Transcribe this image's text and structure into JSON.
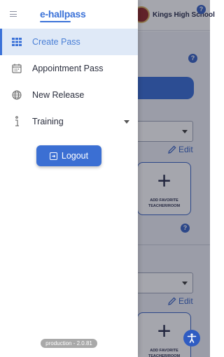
{
  "app": {
    "logo": "e-hallpass"
  },
  "menu": {
    "items": [
      {
        "label": "Create Pass",
        "icon": "grid-icon",
        "active": true
      },
      {
        "label": "Appointment Pass",
        "icon": "calendar-icon",
        "active": false
      },
      {
        "label": "New Release",
        "icon": "globe-icon",
        "active": false
      },
      {
        "label": "Training",
        "icon": "info-icon",
        "active": false
      }
    ],
    "logout_label": "Logout",
    "version": "production - 2.0.81"
  },
  "background": {
    "school_name": "Kings High School",
    "help_glyph": "?",
    "edit_label": "Edit",
    "favorite_card_label": "ADD FAVORITE TEACHER/ROOM"
  },
  "colors": {
    "accent": "#3b72d8",
    "active_item_bg": "#dfe9f7",
    "logout_button": "#3b6fd3"
  }
}
